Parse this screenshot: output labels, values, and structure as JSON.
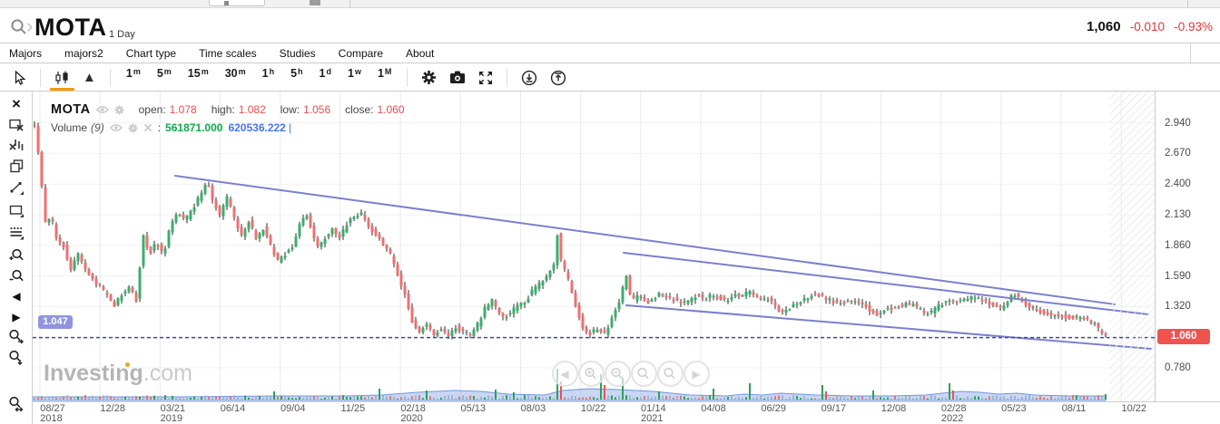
{
  "header": {
    "symbol": "MOTA",
    "timeframe_label": "1 Day",
    "price": "1,060",
    "change": "-0.010",
    "change_pct": "-0.93%"
  },
  "menu": {
    "items": [
      "Majors",
      "majors2",
      "Chart type",
      "Time scales",
      "Studies",
      "Compare",
      "About"
    ]
  },
  "toolbar": {
    "timeframes": [
      {
        "num": "1",
        "unit": "m",
        "selected": false
      },
      {
        "num": "5",
        "unit": "m",
        "selected": false
      },
      {
        "num": "15",
        "unit": "m",
        "selected": false
      },
      {
        "num": "30",
        "unit": "m",
        "selected": false
      },
      {
        "num": "1",
        "unit": "h",
        "selected": false
      },
      {
        "num": "5",
        "unit": "h",
        "selected": false
      },
      {
        "num": "1",
        "unit": "d",
        "selected": true
      },
      {
        "num": "1",
        "unit": "w",
        "selected": false
      },
      {
        "num": "1",
        "unit": "M",
        "selected": false
      }
    ]
  },
  "icons": {
    "chevron": "›",
    "area_glyph": "▲",
    "close_glyph": "×",
    "pan_left": "◀",
    "pan_right": "▶"
  },
  "legend": {
    "symbol": "MOTA",
    "open_label": "open:",
    "open": "1.078",
    "high_label": "high:",
    "high": "1.082",
    "low_label": "low:",
    "low": "1.056",
    "close_label": "close:",
    "close": "1.060",
    "volume_label": "Volume",
    "volume_param": "(9)",
    "volume_sep": ":",
    "volume_value": "561871.000",
    "volume_ma_value": "620536.222",
    "cursor": "|"
  },
  "watermark": {
    "main": "Investing",
    "suffix": ".com"
  },
  "price_line_label": "1.047",
  "last_price_badge": "1.060",
  "chart_data": {
    "type": "candlestick",
    "symbol": "MOTA",
    "interval": "1 Day",
    "ohlc": {
      "open": 1.078,
      "high": 1.082,
      "low": 1.056,
      "close": 1.06
    },
    "y_ticks": [
      "2.940",
      "2.670",
      "2.400",
      "2.130",
      "1.860",
      "1.590",
      "1.320",
      "0.780"
    ],
    "y_tick_values": [
      2.94,
      2.67,
      2.4,
      2.13,
      1.86,
      1.59,
      1.32,
      0.78
    ],
    "x_ticks": [
      {
        "a": "08/27",
        "b": "2018"
      },
      {
        "a": "12/28",
        "b": ""
      },
      {
        "a": "03/21",
        "b": "2019"
      },
      {
        "a": "06/14",
        "b": ""
      },
      {
        "a": "09/04",
        "b": ""
      },
      {
        "a": "11/25",
        "b": ""
      },
      {
        "a": "02/18",
        "b": "2020"
      },
      {
        "a": "05/13",
        "b": ""
      },
      {
        "a": "08/03",
        "b": ""
      },
      {
        "a": "10/22",
        "b": ""
      },
      {
        "a": "01/14",
        "b": "2021"
      },
      {
        "a": "04/08",
        "b": ""
      },
      {
        "a": "06/29",
        "b": ""
      },
      {
        "a": "09/17",
        "b": ""
      },
      {
        "a": "12/08",
        "b": ""
      },
      {
        "a": "02/28",
        "b": "2022"
      },
      {
        "a": "05/23",
        "b": ""
      },
      {
        "a": "08/11",
        "b": ""
      },
      {
        "a": "10/22",
        "b": ""
      }
    ],
    "horizontal_line_price": 1.047,
    "last_price": 1.06,
    "trendlines": [
      {
        "x1": 193,
        "p1": 2.474,
        "x2": 1228,
        "p2": 1.34
      },
      {
        "x1": 687,
        "p1": 1.795,
        "x2": 1265,
        "p2": 1.252
      },
      {
        "x1": 690,
        "p1": 1.332,
        "x2": 1268,
        "p2": 0.948
      }
    ],
    "price_anchors": [
      [
        38,
        2.92
      ],
      [
        44,
        2.55
      ],
      [
        50,
        2.07
      ],
      [
        56,
        2.12
      ],
      [
        62,
        1.94
      ],
      [
        70,
        1.85
      ],
      [
        78,
        1.66
      ],
      [
        86,
        1.78
      ],
      [
        94,
        1.65
      ],
      [
        102,
        1.55
      ],
      [
        110,
        1.5
      ],
      [
        118,
        1.42
      ],
      [
        126,
        1.33
      ],
      [
        134,
        1.42
      ],
      [
        142,
        1.5
      ],
      [
        150,
        1.38
      ],
      [
        158,
        1.95
      ],
      [
        164,
        1.78
      ],
      [
        172,
        1.88
      ],
      [
        180,
        1.78
      ],
      [
        188,
        2.05
      ],
      [
        196,
        2.15
      ],
      [
        204,
        2.08
      ],
      [
        212,
        2.18
      ],
      [
        220,
        2.3
      ],
      [
        228,
        2.43
      ],
      [
        234,
        2.25
      ],
      [
        242,
        2.12
      ],
      [
        250,
        2.28
      ],
      [
        258,
        2.1
      ],
      [
        266,
        1.95
      ],
      [
        274,
        2.08
      ],
      [
        282,
        1.92
      ],
      [
        290,
        2.01
      ],
      [
        298,
        1.86
      ],
      [
        306,
        1.72
      ],
      [
        314,
        1.78
      ],
      [
        322,
        1.85
      ],
      [
        330,
        2.05
      ],
      [
        338,
        2.12
      ],
      [
        344,
        1.98
      ],
      [
        350,
        1.85
      ],
      [
        358,
        1.92
      ],
      [
        366,
        2.0
      ],
      [
        374,
        1.92
      ],
      [
        382,
        2.05
      ],
      [
        390,
        2.12
      ],
      [
        398,
        2.14
      ],
      [
        406,
        2.03
      ],
      [
        414,
        1.95
      ],
      [
        422,
        1.88
      ],
      [
        430,
        1.78
      ],
      [
        438,
        1.6
      ],
      [
        446,
        1.42
      ],
      [
        454,
        1.18
      ],
      [
        462,
        1.1
      ],
      [
        470,
        1.16
      ],
      [
        478,
        1.08
      ],
      [
        486,
        1.13
      ],
      [
        494,
        1.07
      ],
      [
        502,
        1.14
      ],
      [
        510,
        1.1
      ],
      [
        518,
        1.07
      ],
      [
        526,
        1.16
      ],
      [
        534,
        1.3
      ],
      [
        542,
        1.37
      ],
      [
        548,
        1.28
      ],
      [
        556,
        1.22
      ],
      [
        564,
        1.29
      ],
      [
        572,
        1.33
      ],
      [
        580,
        1.38
      ],
      [
        588,
        1.48
      ],
      [
        596,
        1.53
      ],
      [
        604,
        1.6
      ],
      [
        610,
        1.68
      ],
      [
        614,
        1.95
      ],
      [
        618,
        1.72
      ],
      [
        624,
        1.6
      ],
      [
        630,
        1.45
      ],
      [
        636,
        1.28
      ],
      [
        642,
        1.12
      ],
      [
        650,
        1.08
      ],
      [
        658,
        1.13
      ],
      [
        666,
        1.08
      ],
      [
        674,
        1.22
      ],
      [
        680,
        1.32
      ],
      [
        686,
        1.48
      ],
      [
        688,
        1.73
      ],
      [
        692,
        1.45
      ],
      [
        698,
        1.38
      ],
      [
        704,
        1.42
      ],
      [
        712,
        1.36
      ],
      [
        720,
        1.38
      ],
      [
        728,
        1.44
      ],
      [
        736,
        1.4
      ],
      [
        744,
        1.38
      ],
      [
        752,
        1.34
      ],
      [
        760,
        1.38
      ],
      [
        768,
        1.42
      ],
      [
        776,
        1.38
      ],
      [
        784,
        1.43
      ],
      [
        792,
        1.4
      ],
      [
        800,
        1.36
      ],
      [
        808,
        1.44
      ],
      [
        816,
        1.4
      ],
      [
        824,
        1.45
      ],
      [
        832,
        1.42
      ],
      [
        840,
        1.38
      ],
      [
        848,
        1.39
      ],
      [
        856,
        1.3
      ],
      [
        864,
        1.26
      ],
      [
        872,
        1.32
      ],
      [
        880,
        1.36
      ],
      [
        888,
        1.4
      ],
      [
        896,
        1.43
      ],
      [
        904,
        1.42
      ],
      [
        912,
        1.38
      ],
      [
        920,
        1.36
      ],
      [
        928,
        1.34
      ],
      [
        936,
        1.37
      ],
      [
        944,
        1.36
      ],
      [
        952,
        1.35
      ],
      [
        960,
        1.27
      ],
      [
        968,
        1.25
      ],
      [
        976,
        1.3
      ],
      [
        984,
        1.3
      ],
      [
        992,
        1.33
      ],
      [
        1000,
        1.34
      ],
      [
        1008,
        1.33
      ],
      [
        1016,
        1.28
      ],
      [
        1024,
        1.26
      ],
      [
        1032,
        1.32
      ],
      [
        1040,
        1.35
      ],
      [
        1048,
        1.36
      ],
      [
        1056,
        1.37
      ],
      [
        1064,
        1.39
      ],
      [
        1072,
        1.4
      ],
      [
        1080,
        1.39
      ],
      [
        1088,
        1.36
      ],
      [
        1096,
        1.32
      ],
      [
        1104,
        1.3
      ],
      [
        1112,
        1.4
      ],
      [
        1118,
        1.43
      ],
      [
        1126,
        1.36
      ],
      [
        1134,
        1.31
      ],
      [
        1142,
        1.29
      ],
      [
        1150,
        1.26
      ],
      [
        1158,
        1.24
      ],
      [
        1166,
        1.25
      ],
      [
        1174,
        1.23
      ],
      [
        1182,
        1.22
      ],
      [
        1190,
        1.22
      ],
      [
        1198,
        1.21
      ],
      [
        1206,
        1.16
      ],
      [
        1212,
        1.1
      ],
      [
        1218,
        1.06
      ]
    ],
    "volume_spikes": [
      [
        160,
        8,
        "g"
      ],
      [
        302,
        9,
        "g"
      ],
      [
        417,
        12,
        "g"
      ],
      [
        452,
        26,
        "g"
      ],
      [
        470,
        10,
        "g"
      ],
      [
        500,
        13,
        "g"
      ],
      [
        520,
        10,
        "g"
      ],
      [
        545,
        11,
        "g"
      ],
      [
        565,
        8,
        "g"
      ],
      [
        614,
        34,
        "g"
      ],
      [
        617,
        20,
        "r"
      ],
      [
        640,
        12,
        "g"
      ],
      [
        662,
        28,
        "g"
      ],
      [
        665,
        16,
        "r"
      ],
      [
        686,
        24,
        "g"
      ],
      [
        700,
        12,
        "g"
      ],
      [
        726,
        9,
        "g"
      ],
      [
        786,
        12,
        "g"
      ],
      [
        812,
        14,
        "g"
      ],
      [
        820,
        10,
        "g"
      ],
      [
        826,
        18,
        "g"
      ],
      [
        860,
        10,
        "g"
      ],
      [
        907,
        16,
        "g"
      ],
      [
        910,
        9,
        "r"
      ],
      [
        963,
        10,
        "g"
      ],
      [
        1020,
        8,
        "g"
      ],
      [
        1047,
        18,
        "g"
      ],
      [
        1050,
        10,
        "r"
      ],
      [
        1080,
        10,
        "g"
      ],
      [
        1120,
        12,
        "g"
      ],
      [
        1140,
        8,
        "g"
      ],
      [
        1218,
        6,
        "g"
      ]
    ],
    "volume_ma_profile": [
      [
        36,
        3
      ],
      [
        120,
        3
      ],
      [
        200,
        3
      ],
      [
        300,
        4
      ],
      [
        380,
        4
      ],
      [
        420,
        5
      ],
      [
        460,
        8
      ],
      [
        500,
        10
      ],
      [
        530,
        9
      ],
      [
        560,
        6
      ],
      [
        600,
        5
      ],
      [
        620,
        10
      ],
      [
        650,
        12
      ],
      [
        680,
        11
      ],
      [
        700,
        10
      ],
      [
        720,
        9
      ],
      [
        740,
        7
      ],
      [
        760,
        5
      ],
      [
        800,
        4
      ],
      [
        820,
        6
      ],
      [
        840,
        5
      ],
      [
        860,
        7
      ],
      [
        880,
        6
      ],
      [
        900,
        5
      ],
      [
        940,
        4
      ],
      [
        980,
        4
      ],
      [
        1020,
        5
      ],
      [
        1047,
        8
      ],
      [
        1060,
        9
      ],
      [
        1080,
        8
      ],
      [
        1100,
        6
      ],
      [
        1120,
        7
      ],
      [
        1140,
        5
      ],
      [
        1180,
        4
      ],
      [
        1218,
        4
      ]
    ],
    "colors": {
      "up": "#3CAD6E",
      "down": "#EF7070",
      "wick": "#2b2b2b",
      "trendline": "#7B80CC",
      "hline": "#4345A8",
      "price_tag_bg": "#9094E0",
      "last_badge_bg": "#EF5350",
      "vol_ma_fill": "rgba(150,175,230,0.5)",
      "vol_ma_line": "#7296DD",
      "vol_misc": "#9DB3D6",
      "vol_green": "#2CA05A",
      "vol_red": "#D97A7A",
      "grid_v": "#e9e9e9",
      "grid_h": "#f1f1f1",
      "accent_orange": "#F59B00"
    }
  }
}
